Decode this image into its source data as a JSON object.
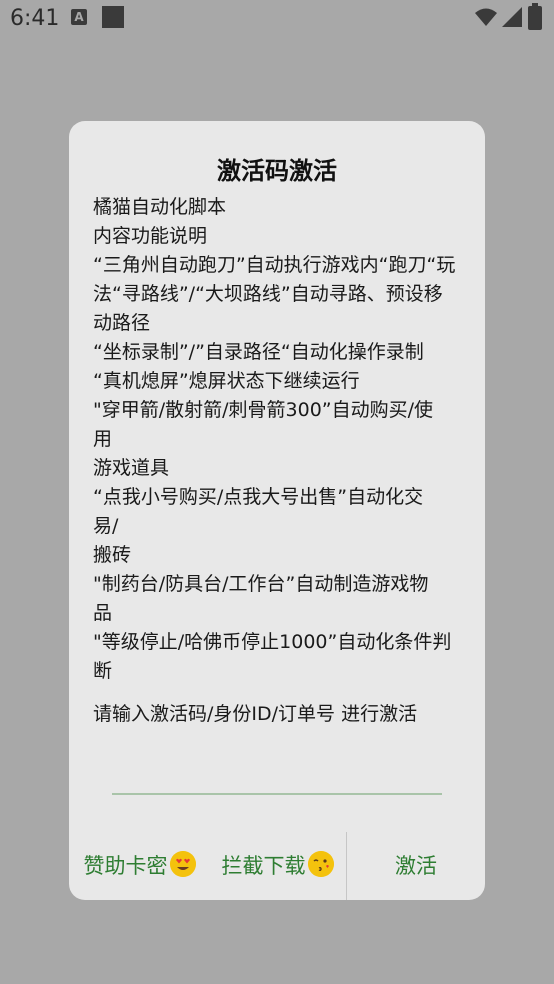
{
  "status_bar": {
    "time": "6:41",
    "notification_icon_label": "A"
  },
  "dialog": {
    "title": "激活码激活",
    "message_lines": [
      "橘猫自动化脚本",
      "内容功能说明",
      "“三角州自动跑刀”自动执行游戏内“跑刀“玩",
      "法“寻路线”/“大坝路线”自动寻路、预设移",
      "动路径",
      "“坐标录制”/”自录路径“自动化操作录制",
      "“真机熄屏”熄屏状态下继续运行",
      "\"穿甲箭/散射箭/刺骨箭300”自动购买/使",
      "用",
      "游戏道具",
      "“点我小号购买/点我大号出售”自动化交",
      "易/",
      "搬砖",
      "\"制药台/防具台/工作台”自动制造游戏物",
      "品",
      "\"等级停止/哈佛币停止1000”自动化条件判",
      "断",
      "请输入激活码/身份ID/订单号 进行激活"
    ],
    "input": {
      "value": "",
      "placeholder": ""
    },
    "buttons": {
      "sponsor_label": "赞助卡密",
      "intercept_label": "拦截下载",
      "activate_label": "激活"
    },
    "accent_color": "#2e7d32"
  }
}
